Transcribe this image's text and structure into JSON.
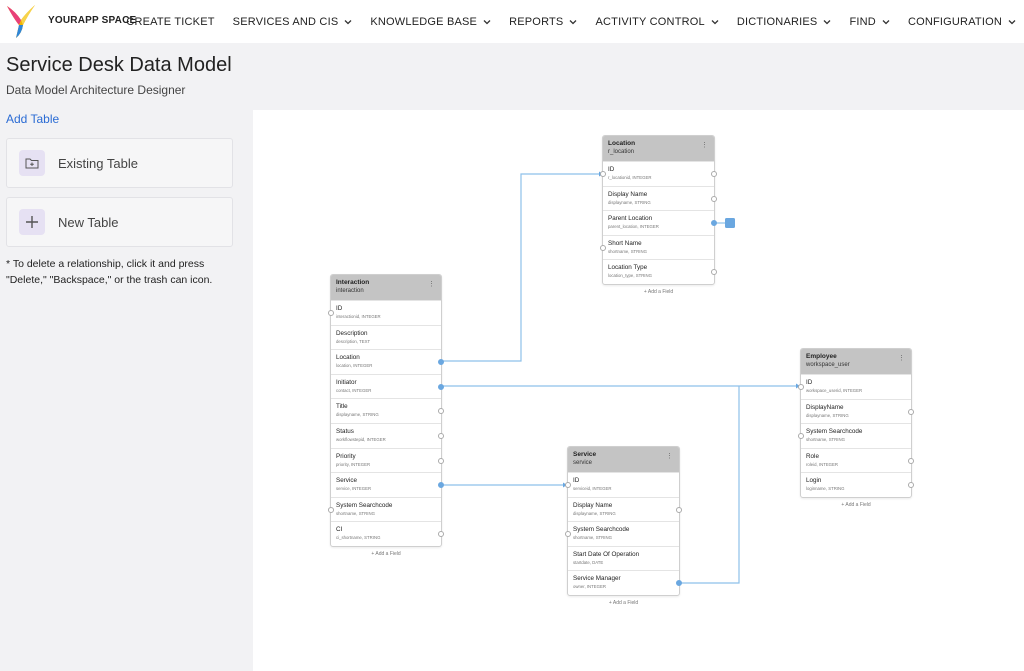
{
  "app": {
    "brand": "YOURAPP SPACE"
  },
  "nav": [
    {
      "label": "CREATE TICKET",
      "dropdown": false
    },
    {
      "label": "SERVICES AND CIS",
      "dropdown": true
    },
    {
      "label": "KNOWLEDGE BASE",
      "dropdown": true
    },
    {
      "label": "REPORTS",
      "dropdown": true
    },
    {
      "label": "ACTIVITY CONTROL",
      "dropdown": true
    },
    {
      "label": "DICTIONARIES",
      "dropdown": true
    },
    {
      "label": "FIND",
      "dropdown": true
    },
    {
      "label": "CONFIGURATION",
      "dropdown": true
    }
  ],
  "header": {
    "title": "Service Desk Data Model",
    "subtitle": "Data Model Architecture Designer"
  },
  "sidebar": {
    "add_table": "Add Table",
    "existing_table": "Existing Table",
    "new_table": "New Table",
    "note": "* To delete a relationship, click it and press \"Delete,\" \"Backspace,\" or the trash can icon."
  },
  "add_field_label": "+ Add a Field",
  "tables": {
    "location": {
      "title": "Location",
      "sub": "r_location",
      "fields": [
        {
          "name": "ID",
          "type": "r_locationid, INTEGER"
        },
        {
          "name": "Display Name",
          "type": "displayname, STRING"
        },
        {
          "name": "Parent Location",
          "type": "parent_location, INTEGER"
        },
        {
          "name": "Short Name",
          "type": "shortname, STRING"
        },
        {
          "name": "Location Type",
          "type": "location_type, STRING"
        }
      ]
    },
    "interaction": {
      "title": "Interaction",
      "sub": "interaction",
      "fields": [
        {
          "name": "ID",
          "type": "interactionid, INTEGER"
        },
        {
          "name": "Description",
          "type": "description, TEXT"
        },
        {
          "name": "Location",
          "type": "location, INTEGER"
        },
        {
          "name": "Initiator",
          "type": "contact, INTEGER"
        },
        {
          "name": "Title",
          "type": "displayname, STRING"
        },
        {
          "name": "Status",
          "type": "workflowstepid, INTEGER"
        },
        {
          "name": "Priority",
          "type": "priority, INTEGER"
        },
        {
          "name": "Service",
          "type": "service, INTEGER"
        },
        {
          "name": "System Searchcode",
          "type": "shortname, STRING"
        },
        {
          "name": "CI",
          "type": "ci_shortname, STRING"
        }
      ]
    },
    "service": {
      "title": "Service",
      "sub": "service",
      "fields": [
        {
          "name": "ID",
          "type": "serviceid, INTEGER"
        },
        {
          "name": "Display Name",
          "type": "displayname, STRING"
        },
        {
          "name": "System Searchcode",
          "type": "shortname, STRING"
        },
        {
          "name": "Start Date Of Operation",
          "type": "startdate, DATE"
        },
        {
          "name": "Service Manager",
          "type": "owner, INTEGER"
        }
      ]
    },
    "employee": {
      "title": "Employee",
      "sub": "workspace_user",
      "fields": [
        {
          "name": "ID",
          "type": "workspace_userid, INTEGER"
        },
        {
          "name": "DisplayName",
          "type": "displayname, STRING"
        },
        {
          "name": "System Searchcode",
          "type": "shortname, STRING"
        },
        {
          "name": "Role",
          "type": "roleid, INTEGER"
        },
        {
          "name": "Login",
          "type": "loginname, STRING"
        }
      ]
    }
  },
  "colors": {
    "accent": "#6aa7e0",
    "link": "#2b6cd4",
    "panel": "#f2f2f4",
    "header_bg": "#c4c4c4"
  }
}
